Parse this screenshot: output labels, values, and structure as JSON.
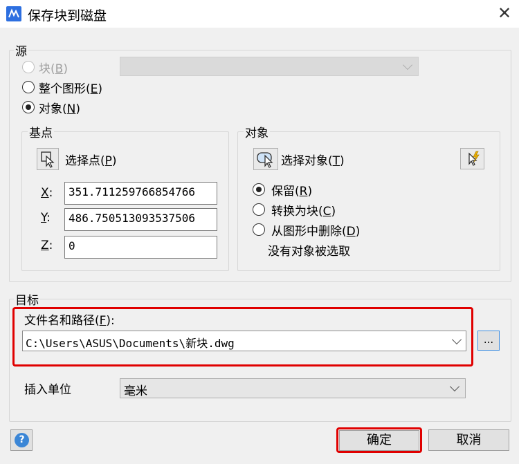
{
  "window": {
    "title": "保存块到磁盘"
  },
  "source": {
    "label": "源",
    "block_option": {
      "label": "块(",
      "key": "B",
      "suffix": ")"
    },
    "drawing_option": {
      "label": "整个图形(",
      "key": "E",
      "suffix": ")"
    },
    "objects_option": {
      "label": "对象(",
      "key": "N",
      "suffix": ")"
    },
    "block_combo_value": ""
  },
  "base_point": {
    "label": "基点",
    "pick_label": "选择点(",
    "pick_key": "P",
    "pick_suffix": ")",
    "x_key": "X",
    "y_key": "Y",
    "z_key": "Z",
    "coord_suffix": ":",
    "x": "351.711259766854766",
    "y": "486.750513093537506",
    "z": "0"
  },
  "objects": {
    "label": "对象",
    "select_label": "选择对象(",
    "select_key": "T",
    "select_suffix": ")",
    "retain": {
      "label": "保留(",
      "key": "R",
      "suffix": ")"
    },
    "convert": {
      "label": "转换为块(",
      "key": "C",
      "suffix": ")"
    },
    "delete": {
      "label": "从图形中删除(",
      "key": "D",
      "suffix": ")"
    },
    "status": "没有对象被选取"
  },
  "target": {
    "label": "目标",
    "path_label": "文件名和路径(",
    "path_key": "F",
    "path_suffix": "):",
    "path": "C:\\Users\\ASUS\\Documents\\新块.dwg",
    "browse": "...",
    "units_label": "插入单位",
    "units_value": "毫米"
  },
  "buttons": {
    "ok": "确定",
    "cancel": "取消",
    "help": "?"
  },
  "colors": {
    "highlight": "#e00000",
    "accent": "#2d6fe0"
  }
}
